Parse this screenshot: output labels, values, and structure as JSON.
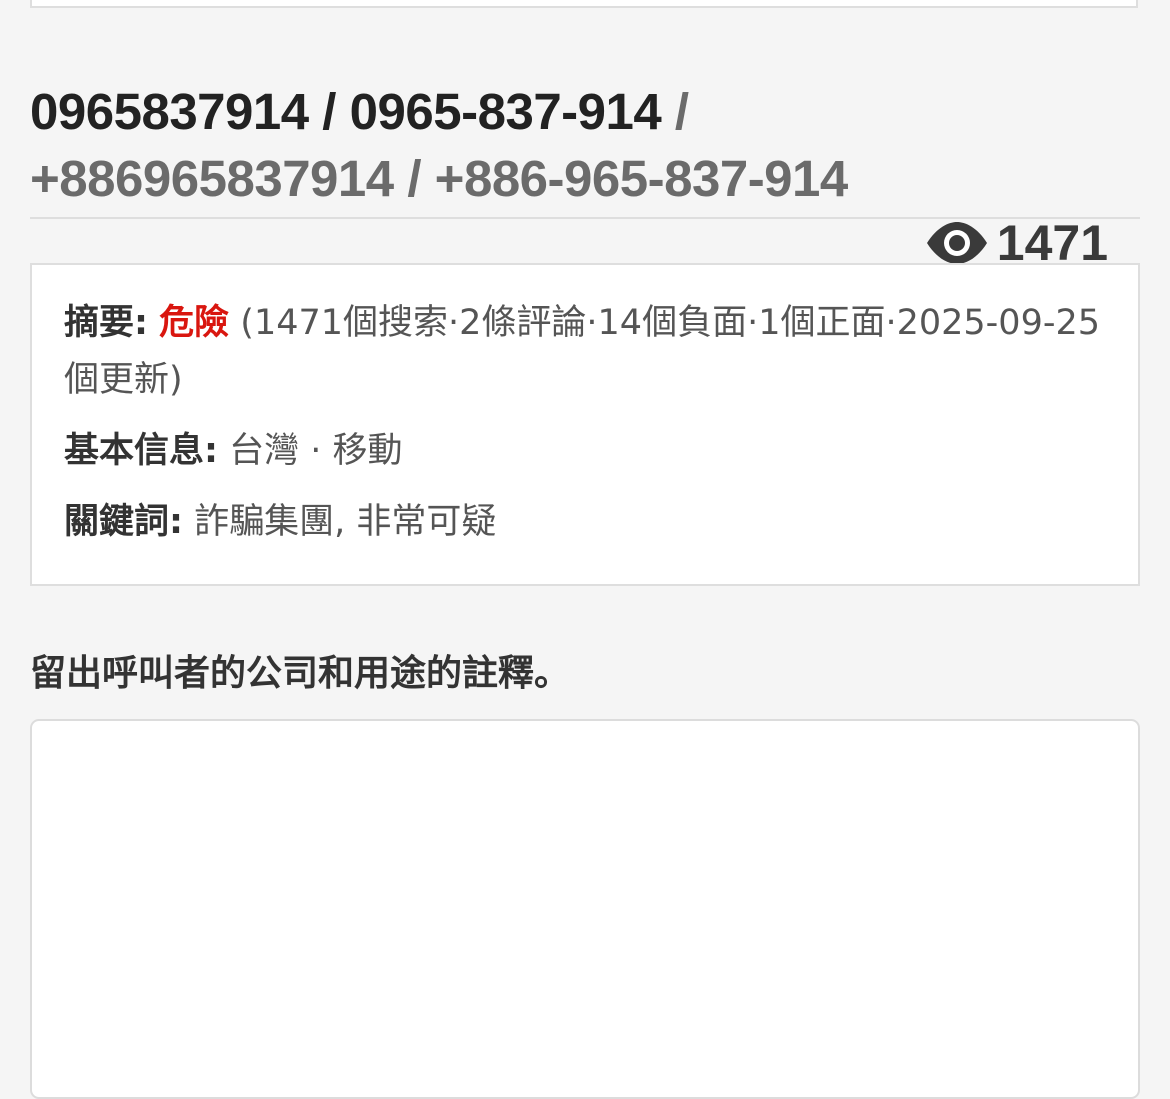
{
  "header": {
    "number_local": "0965837914",
    "number_local_dashed": "0965-837-914",
    "number_intl": "+886965837914",
    "number_intl_dashed": "+886-965-837-914",
    "separator": " / "
  },
  "views": {
    "icon": "eye-icon",
    "count": "1471"
  },
  "summary": {
    "label": "摘要:",
    "rating": "危險",
    "details": "(1471個搜索·2條評論·14個負面·1個正面·2025-09-25個更新)",
    "rating_color": "#d9160f"
  },
  "basic_info": {
    "label": "基本信息:",
    "value": "台灣 · 移動"
  },
  "keywords": {
    "label": "關鍵詞:",
    "value": "詐騙集團, 非常可疑"
  },
  "comment": {
    "prompt": "留出呼叫者的公司和用途的註釋。",
    "value": "",
    "placeholder": ""
  }
}
